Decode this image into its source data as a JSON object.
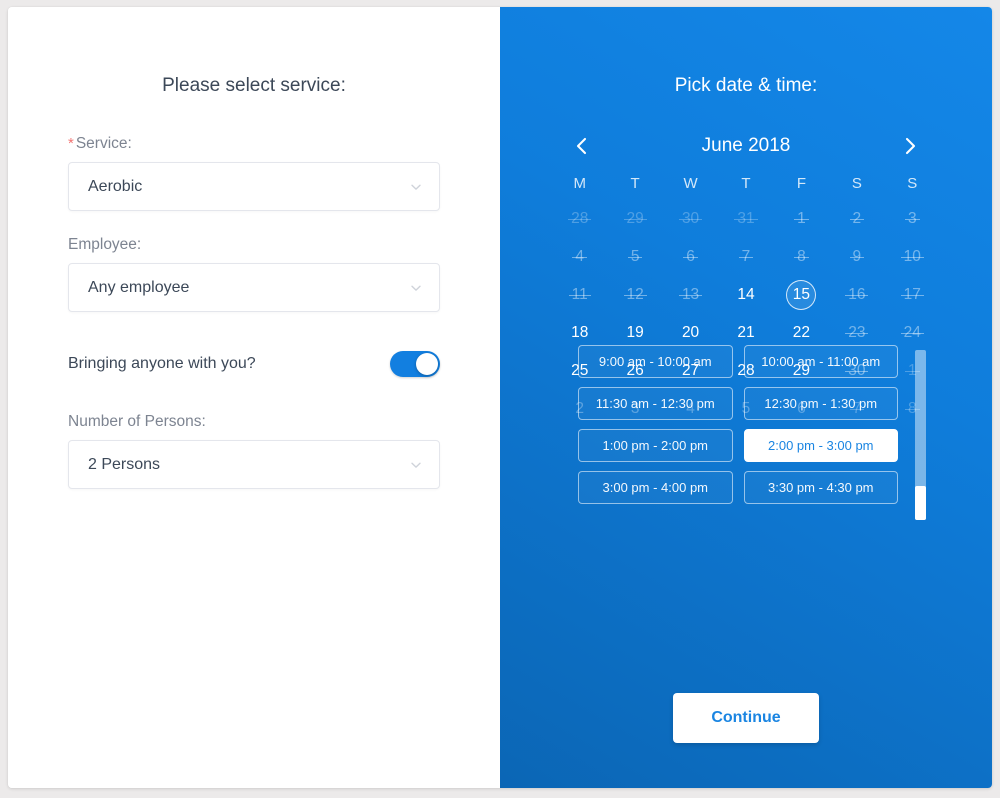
{
  "left": {
    "title": "Please select service:",
    "service": {
      "label": "Service:",
      "required_marker": "*",
      "value": "Aerobic",
      "icon": "chevron-down-icon"
    },
    "employee": {
      "label": "Employee:",
      "value": "Any employee",
      "icon": "chevron-down-icon"
    },
    "bringing": {
      "label": "Bringing anyone with you?",
      "state": "on"
    },
    "persons": {
      "label": "Number of Persons:",
      "value": "2 Persons",
      "icon": "chevron-down-icon"
    }
  },
  "right": {
    "title": "Pick date & time:",
    "calendar": {
      "month_label": "June 2018",
      "prev_icon": "chevron-left-icon",
      "next_icon": "chevron-right-icon",
      "weekdays": [
        "M",
        "T",
        "W",
        "T",
        "F",
        "S",
        "S"
      ],
      "weeks": [
        [
          {
            "n": "28",
            "state": "muted-struck"
          },
          {
            "n": "29",
            "state": "muted-struck"
          },
          {
            "n": "30",
            "state": "muted-struck"
          },
          {
            "n": "31",
            "state": "muted-struck"
          },
          {
            "n": "1",
            "state": "struck"
          },
          {
            "n": "2",
            "state": "struck"
          },
          {
            "n": "3",
            "state": "struck"
          }
        ],
        [
          {
            "n": "4",
            "state": "struck"
          },
          {
            "n": "5",
            "state": "struck"
          },
          {
            "n": "6",
            "state": "struck"
          },
          {
            "n": "7",
            "state": "struck"
          },
          {
            "n": "8",
            "state": "struck"
          },
          {
            "n": "9",
            "state": "struck"
          },
          {
            "n": "10",
            "state": "struck"
          }
        ],
        [
          {
            "n": "11",
            "state": "struck"
          },
          {
            "n": "12",
            "state": "struck"
          },
          {
            "n": "13",
            "state": "struck"
          },
          {
            "n": "14",
            "state": "available"
          },
          {
            "n": "15",
            "state": "selected"
          },
          {
            "n": "16",
            "state": "struck"
          },
          {
            "n": "17",
            "state": "struck"
          }
        ],
        [
          {
            "n": "18",
            "state": "available"
          },
          {
            "n": "19",
            "state": "available"
          },
          {
            "n": "20",
            "state": "available"
          },
          {
            "n": "21",
            "state": "available"
          },
          {
            "n": "22",
            "state": "available"
          },
          {
            "n": "23",
            "state": "struck"
          },
          {
            "n": "24",
            "state": "struck"
          }
        ],
        [
          {
            "n": "25",
            "state": "available"
          },
          {
            "n": "26",
            "state": "available"
          },
          {
            "n": "27",
            "state": "available"
          },
          {
            "n": "28",
            "state": "available"
          },
          {
            "n": "29",
            "state": "available"
          },
          {
            "n": "30",
            "state": "struck"
          },
          {
            "n": "1",
            "state": "muted-struck"
          }
        ],
        [
          {
            "n": "2",
            "state": "muted"
          },
          {
            "n": "3",
            "state": "muted"
          },
          {
            "n": "4",
            "state": "muted"
          },
          {
            "n": "5",
            "state": "muted"
          },
          {
            "n": "6",
            "state": "muted"
          },
          {
            "n": "7",
            "state": "muted-struck"
          },
          {
            "n": "8",
            "state": "muted-struck"
          }
        ]
      ]
    },
    "time_slots": [
      {
        "label": "9:00 am - 10:00 am",
        "selected": false
      },
      {
        "label": "10:00 am - 11:00 am",
        "selected": false
      },
      {
        "label": "11:30 am - 12:30 pm",
        "selected": false
      },
      {
        "label": "12:30 pm - 1:30 pm",
        "selected": false
      },
      {
        "label": "1:00 pm - 2:00 pm",
        "selected": false
      },
      {
        "label": "2:00 pm - 3:00 pm",
        "selected": true
      },
      {
        "label": "3:00 pm - 4:00 pm",
        "selected": false
      },
      {
        "label": "3:30 pm - 4:30 pm",
        "selected": false
      }
    ],
    "continue_label": "Continue"
  },
  "colors": {
    "accent_blue": "#127fe0",
    "panel_blue_light": "#1487e8",
    "panel_blue_dark": "#0b66b5",
    "text_dark": "#3c4858",
    "text_muted": "#8b92a0",
    "required_red": "#f27573",
    "white": "#ffffff"
  }
}
